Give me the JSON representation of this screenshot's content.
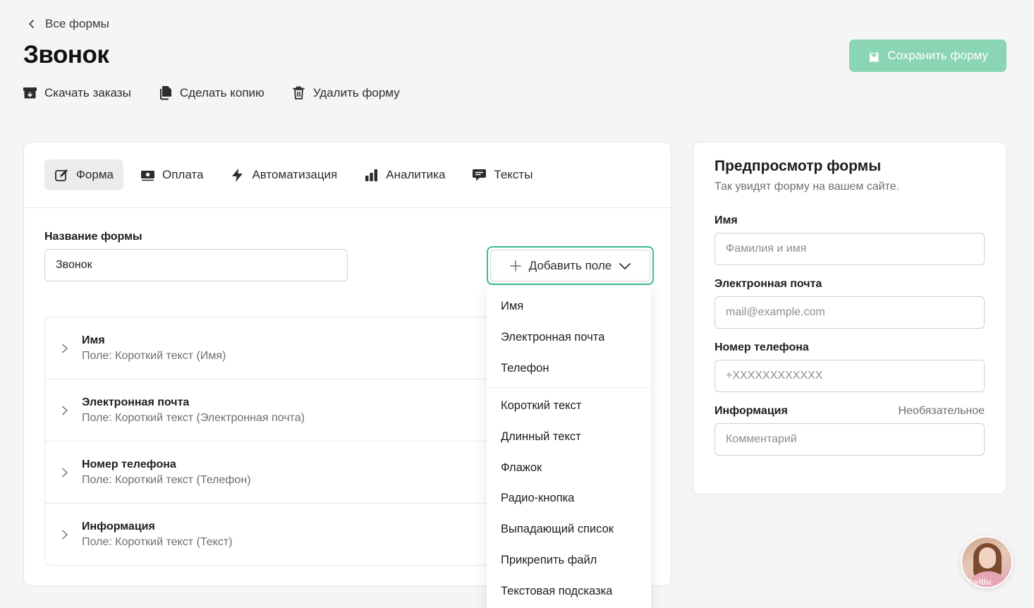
{
  "header": {
    "back_label": "Все формы",
    "title": "Звонок",
    "save_label": "Сохранить форму"
  },
  "actions": {
    "download": "Скачать заказы",
    "copy": "Сделать копию",
    "delete": "Удалить форму"
  },
  "tabs": [
    {
      "label": "Форма",
      "icon": "edit-icon"
    },
    {
      "label": "Оплата",
      "icon": "money-icon"
    },
    {
      "label": "Автоматизация",
      "icon": "lightning-icon"
    },
    {
      "label": "Аналитика",
      "icon": "bar-chart-icon"
    },
    {
      "label": "Тексты",
      "icon": "message-icon"
    }
  ],
  "form": {
    "name_label": "Название формы",
    "name_value": "Звонок",
    "add_field_label": "Добавить поле"
  },
  "fields": [
    {
      "name": "Имя",
      "type": "Поле: Короткий текст (Имя)"
    },
    {
      "name": "Электронная почта",
      "type": "Поле: Короткий текст (Электронная почта)"
    },
    {
      "name": "Номер телефона",
      "type": "Поле: Короткий текст (Телефон)"
    },
    {
      "name": "Информация",
      "type": "Поле: Короткий текст (Текст)"
    }
  ],
  "dropdown": {
    "group1": [
      "Имя",
      "Электронная почта",
      "Телефон"
    ],
    "group2": [
      "Короткий текст",
      "Длинный текст",
      "Флажок",
      "Радио-кнопка",
      "Выпадающий список",
      "Прикрепить файл",
      "Текстовая подсказка"
    ]
  },
  "preview": {
    "title": "Предпросмотр формы",
    "subtitle": "Так увидят форму на вашем сайте.",
    "fields": [
      {
        "label": "Имя",
        "placeholder": "Фамилия и имя",
        "optional": ""
      },
      {
        "label": "Электронная почта",
        "placeholder": "mail@example.com",
        "optional": ""
      },
      {
        "label": "Номер телефона",
        "placeholder": "+XXXXXXXXXXXX",
        "optional": ""
      },
      {
        "label": "Информация",
        "placeholder": "Комментарий",
        "optional": "Необязательное"
      }
    ]
  },
  "avatar": {
    "watermark": "kvitlu"
  },
  "colors": {
    "accent": "#36c08a",
    "save_button": "#8ad5b3"
  }
}
